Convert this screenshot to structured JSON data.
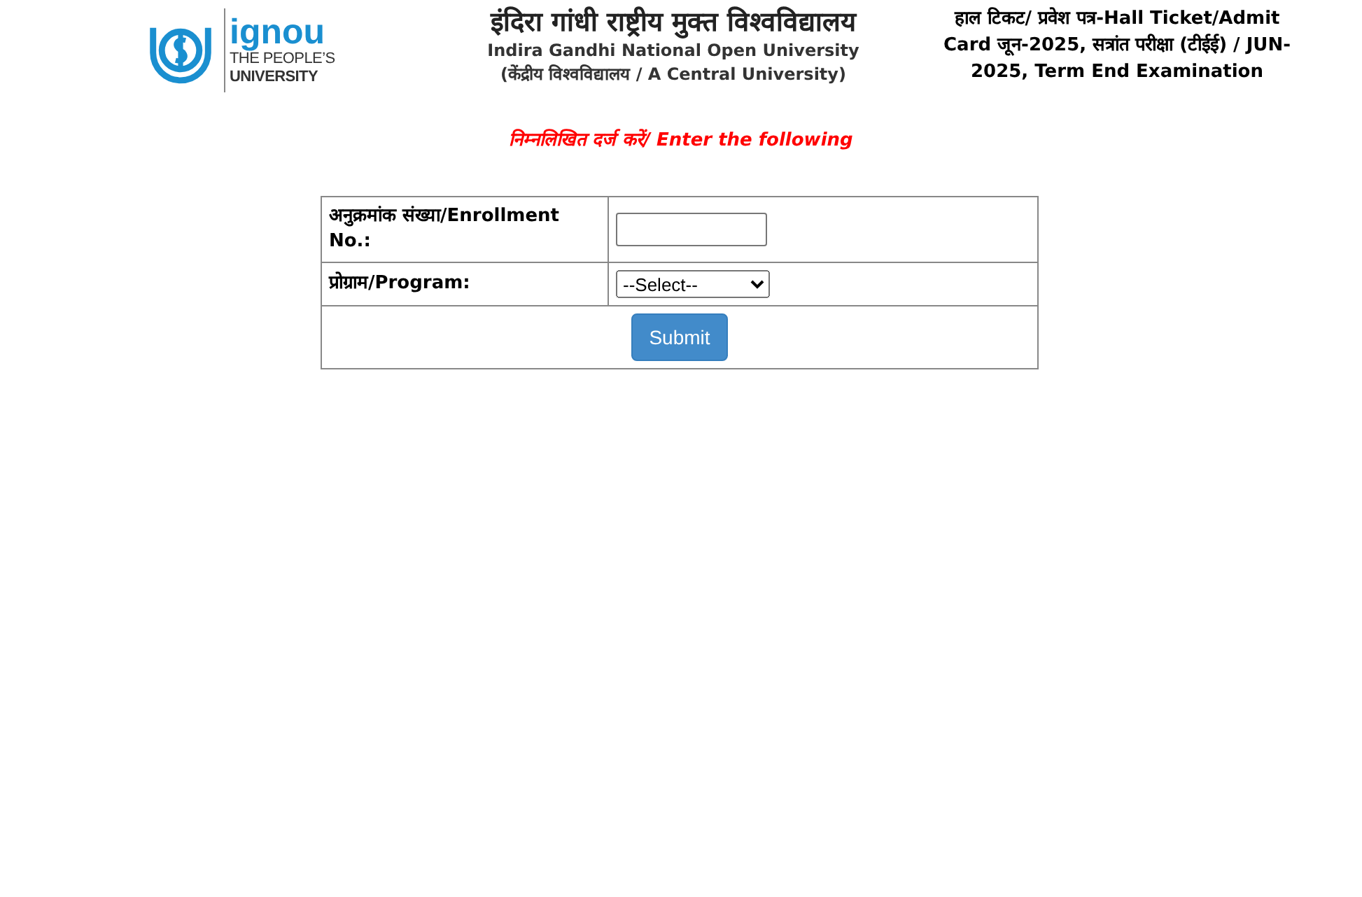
{
  "header": {
    "logo": {
      "wordmark": "ignou",
      "tagline": [
        "THE PEOPLE’S",
        "UNIVERSITY"
      ]
    },
    "title_hindi": "इंदिरा गांधी राष्ट्रीय मुक्त विश्वविद्यालय",
    "title_english": "Indira Gandhi National Open University",
    "subtitle": "(केंद्रीय विश्वविद्यालय / A Central University)",
    "notice": "हाल टिकट/ प्रवेश पत्र-Hall Ticket/Admit Card जून-2025, सत्रांत परीक्षा (टीईई) / JUN-2025, Term End Examination"
  },
  "instruction": "निम्नलिखित दर्ज करें/ Enter the following",
  "form": {
    "rows": [
      {
        "kind": "text",
        "label": "अनुक्रमांक संख्या/Enrollment No.:"
      },
      {
        "kind": "select",
        "label": "प्रोग्राम/Program:",
        "value": "--Select--"
      }
    ],
    "submit": "Submit"
  }
}
